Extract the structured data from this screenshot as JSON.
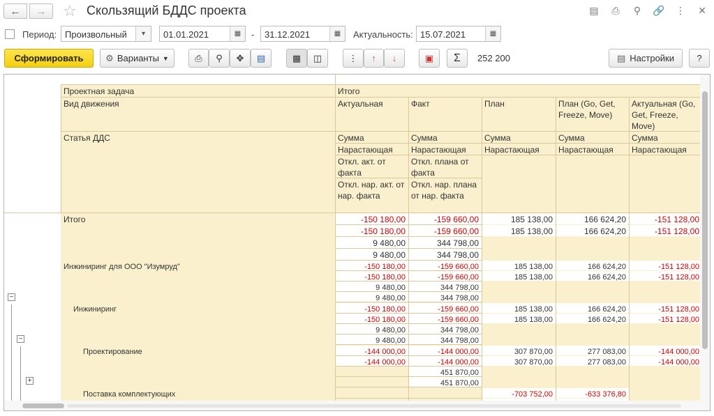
{
  "window": {
    "title": "Скользящий БДДС проекта",
    "back_icon": "arrow-left-icon",
    "forward_icon": "arrow-right-icon",
    "favorite_icon": "star-icon",
    "tools": [
      "save-icon",
      "print-icon",
      "preview-icon",
      "link-icon",
      "more-icon",
      "close-icon"
    ]
  },
  "filters": {
    "period_label": "Период:",
    "period_type": "Произвольный",
    "date_from": "01.01.2021",
    "dash": "-",
    "date_to": "31.12.2021",
    "actuality_label": "Актуальность:",
    "actuality_date": "15.07.2021"
  },
  "toolbar": {
    "generate": "Сформировать",
    "variants": "Варианты",
    "settings": "Настройки",
    "help": "?",
    "sum_value": "252 200"
  },
  "report": {
    "header": {
      "project_task": "Проектная задача",
      "total": "Итого",
      "movement_type": "Вид движения",
      "article": "Статья ДДС",
      "columns": [
        {
          "title": "Актуальная",
          "row1": "Сумма",
          "row2": "Нарастающая",
          "row3": "Откл. акт. от факта",
          "row4": "Откл. нар. акт. от нар. факта"
        },
        {
          "title": "Факт",
          "row1": "Сумма",
          "row2": "Нарастающая",
          "row3": "Откл. плана от факта",
          "row4": "Откл. нар. плана от нар. факта"
        },
        {
          "title": "План",
          "row1": "Сумма",
          "row2": "Нарастающая"
        },
        {
          "title": "План (Go, Get, Freeze, Move)",
          "row1": "Сумма",
          "row2": "Нарастающая"
        },
        {
          "title": "Актуальная (Go, Get, Freeze, Move)",
          "row1": "Сумма",
          "row2": "Нарастающая"
        }
      ]
    },
    "rows": [
      {
        "label": "Итого",
        "lines": [
          [
            "-150 180,00",
            "-159 660,00",
            "185 138,00",
            "166 624,20",
            "-151 128,00"
          ],
          [
            "-150 180,00",
            "-159 660,00",
            "185 138,00",
            "166 624,20",
            "-151 128,00"
          ],
          [
            "9 480,00",
            "344 798,00",
            "",
            "",
            ""
          ],
          [
            "9 480,00",
            "344 798,00",
            "",
            "",
            ""
          ]
        ]
      },
      {
        "label": "Инжиниринг для ООО \"Изумруд\"",
        "lines": [
          [
            "-150 180,00",
            "-159 660,00",
            "185 138,00",
            "166 624,20",
            "-151 128,00"
          ],
          [
            "-150 180,00",
            "-159 660,00",
            "185 138,00",
            "166 624,20",
            "-151 128,00"
          ],
          [
            "9 480,00",
            "344 798,00",
            "",
            "",
            ""
          ],
          [
            "9 480,00",
            "344 798,00",
            "",
            "",
            ""
          ]
        ]
      },
      {
        "label": "Инжиниринг",
        "lines": [
          [
            "-150 180,00",
            "-159 660,00",
            "185 138,00",
            "166 624,20",
            "-151 128,00"
          ],
          [
            "-150 180,00",
            "-159 660,00",
            "185 138,00",
            "166 624,20",
            "-151 128,00"
          ],
          [
            "9 480,00",
            "344 798,00",
            "",
            "",
            ""
          ],
          [
            "9 480,00",
            "344 798,00",
            "",
            "",
            ""
          ]
        ]
      },
      {
        "label": "Проектирование",
        "lines": [
          [
            "-144 000,00",
            "-144 000,00",
            "307 870,00",
            "277 083,00",
            "-144 000,00"
          ],
          [
            "-144 000,00",
            "-144 000,00",
            "307 870,00",
            "277 083,00",
            "-144 000,00"
          ],
          [
            "",
            "451 870,00",
            "",
            "",
            ""
          ],
          [
            "",
            "451 870,00",
            "",
            "",
            ""
          ]
        ]
      },
      {
        "label": "Поставка комплектующих",
        "lines": [
          [
            "",
            "",
            "-703 752,00",
            "-633 376,80",
            ""
          ],
          [
            "",
            "",
            "-703 752,00",
            "-633 376,80",
            ""
          ]
        ]
      }
    ]
  }
}
